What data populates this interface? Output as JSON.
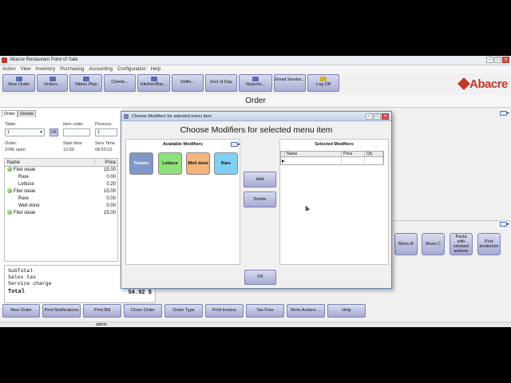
{
  "window": {
    "title": "Abacre Restaurant Point of Sale"
  },
  "menu": [
    "Action",
    "View",
    "Inventory",
    "Purchasing",
    "Accounting",
    "Configuration",
    "Help"
  ],
  "toolbar": {
    "new_order": "New Order",
    "orders": "Orders...",
    "tables_plan": "Tables Plan",
    "clients": "Clients...",
    "kitchen_bar": "Kitchen/Bar...",
    "shifts": "Shifts...",
    "end_of_day": "End of Day",
    "reports": "Reports...",
    "email_sender": "Email Sender...",
    "log_off": "Log Off"
  },
  "logo": {
    "text": "Abacre",
    "color": "#c0392b"
  },
  "order_header": "Order",
  "left": {
    "tabs": [
      "Order",
      "Details"
    ],
    "table_label": "Table:",
    "table_value": "1",
    "ok": "OK",
    "item_code_label": "Item code:",
    "persons_label": "Persons:",
    "persons_value": "1",
    "order_label": "Order:",
    "order_value": "3786 open",
    "start_time_label": "Start time",
    "start_time_value": "12:00",
    "serv_time_label": "Serv Time",
    "serv_time_value": "08:59:22",
    "columns": {
      "name": "Name",
      "price": "Price"
    },
    "rows": [
      {
        "name": "Filet steak",
        "price": "15.00",
        "main": true
      },
      {
        "name": "Rare",
        "price": "0.00",
        "main": false
      },
      {
        "name": "Lettuce",
        "price": "0.20",
        "main": false
      },
      {
        "name": "Filet steak",
        "price": "15.00",
        "main": true
      },
      {
        "name": "Rare",
        "price": "0.00",
        "main": false
      },
      {
        "name": "Well done",
        "price": "0.00",
        "main": false
      },
      {
        "name": "Filet steak",
        "price": "15.00",
        "main": true
      }
    ],
    "totals": {
      "subtotal": "SubTotal",
      "sales_tax": "Sales tax",
      "service_charge": "Service charge",
      "total": "Total",
      "total_value": "54.92 $"
    }
  },
  "menu_items": [
    "Menu B",
    "Menu C",
    "Pasta with smoked salmon",
    "Pork tenderloin"
  ],
  "bottom_buttons": [
    "New Order",
    "Print Notifications",
    "Print Bill",
    "Close Order",
    "Order Type",
    "Print Invoice",
    "Tax Free",
    "More Actions ...",
    "Help"
  ],
  "status": {
    "user": "admin"
  },
  "dialog": {
    "title": "Choose Modifiers for selected menu item",
    "heading": "Choose Modifiers for selected menu item",
    "available_title": "Available Modifiers",
    "selected_title": "Selected Modifiers",
    "modifiers": [
      {
        "label": "Tomato",
        "color": "#7f97c9",
        "text": "#ffffff"
      },
      {
        "label": "Lettuce",
        "color": "#8fe07a",
        "text": "#111111"
      },
      {
        "label": "Well done",
        "color": "#f5b57a",
        "text": "#111111"
      },
      {
        "label": "Rare",
        "color": "#7fd0f2",
        "text": "#111111"
      }
    ],
    "selected_columns": {
      "name": "Name",
      "price": "Price",
      "qty": "Qty"
    },
    "add": "Add",
    "delete": "Delete",
    "ok": "OK"
  }
}
